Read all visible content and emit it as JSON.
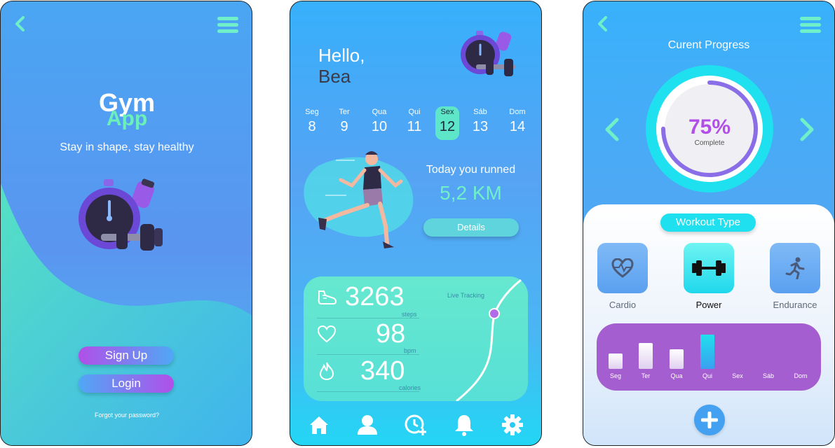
{
  "screen1": {
    "brand_line1": "Gym",
    "brand_line2": "App",
    "tagline": "Stay in shape, stay healthy",
    "signup_label": "Sign Up",
    "login_label": "Login",
    "forgot_label": "Forgot your password?"
  },
  "screen2": {
    "greeting": "Hello,",
    "name": "Bea",
    "days": [
      {
        "name": "Seg",
        "num": "8"
      },
      {
        "name": "Ter",
        "num": "9"
      },
      {
        "name": "Qua",
        "num": "10"
      },
      {
        "name": "Qui",
        "num": "11"
      },
      {
        "name": "Sex",
        "num": "12"
      },
      {
        "name": "Sáb",
        "num": "13"
      },
      {
        "name": "Dom",
        "num": "14"
      }
    ],
    "selected_day_index": 4,
    "run_title": "Today you runned",
    "run_distance": "5,2 KM",
    "details_label": "Details",
    "live_tracking": "Live Tracking",
    "stats": [
      {
        "value": "3263",
        "unit": "steps",
        "icon": "shoe-icon"
      },
      {
        "value": "98",
        "unit": "bpm",
        "icon": "heart-icon"
      },
      {
        "value": "340",
        "unit": "calories",
        "icon": "flame-icon"
      }
    ],
    "nav": [
      "home-icon",
      "profile-icon",
      "clock-add-icon",
      "bell-icon",
      "settings-icon"
    ]
  },
  "screen3": {
    "title": "Curent Progress",
    "percent": "75%",
    "percent_value": 0.75,
    "complete_label": "Complete",
    "workout_type_label": "Workout Type",
    "types": [
      {
        "label": "Cardio",
        "icon": "heart-pulse-icon"
      },
      {
        "label": "Power",
        "icon": "dumbbell-icon"
      },
      {
        "label": "Endurance",
        "icon": "running-icon"
      }
    ],
    "week_bars": [
      {
        "label": "Seg",
        "value": 0.3
      },
      {
        "label": "Ter",
        "value": 0.5
      },
      {
        "label": "Qua",
        "value": 0.38
      },
      {
        "label": "Qui",
        "value": 0.65
      },
      {
        "label": "Sex",
        "value": 0
      },
      {
        "label": "Sáb",
        "value": 0
      },
      {
        "label": "Dom",
        "value": 0
      }
    ]
  },
  "colors": {
    "accent_teal": "#5ee6c8",
    "accent_purple": "#a24fe8",
    "cyan": "#1fe0ee"
  }
}
